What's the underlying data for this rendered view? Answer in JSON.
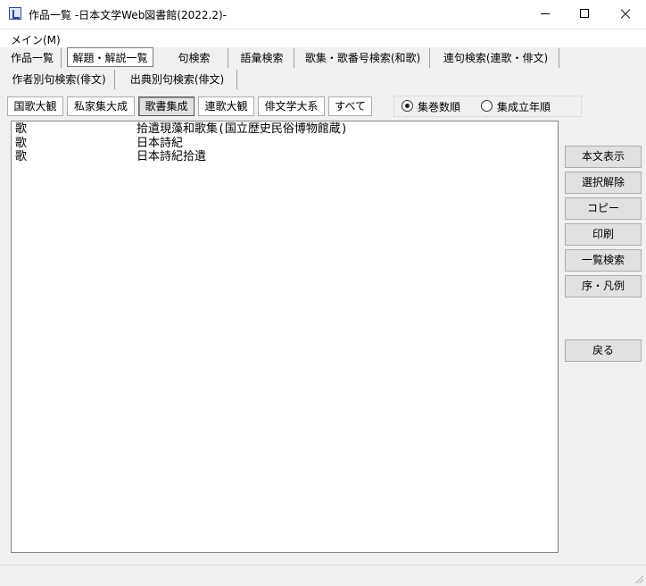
{
  "window": {
    "title": "作品一覧 -日本文学Web図書館(2022.2)-",
    "controls": {
      "minimize": "—",
      "maximize": "☐",
      "close": "✕"
    }
  },
  "menu": {
    "items": [
      "メイン(M)"
    ]
  },
  "tabs": {
    "row1": [
      "作品一覧",
      "解題・解説一覧",
      "句検索",
      "語彙検索",
      "歌集・歌番号検索(和歌)",
      "連句検索(連歌・俳文)"
    ],
    "row2": [
      "作者別句検索(俳文)",
      "出典別句検索(俳文)"
    ],
    "active": "解題・解説一覧"
  },
  "collections": {
    "buttons": [
      "国歌大観",
      "私家集大成",
      "歌書集成",
      "連歌大観",
      "俳文学大系",
      "すべて"
    ],
    "selected": "歌書集成"
  },
  "sort": {
    "options": [
      "集巻数順",
      "集成立年順"
    ],
    "selected": "集巻数順"
  },
  "list": {
    "rows": [
      {
        "type": "歌",
        "title": "拾遺現藻和歌集(国立歴史民俗博物館蔵)"
      },
      {
        "type": "歌",
        "title": "日本詩紀"
      },
      {
        "type": "歌",
        "title": "日本詩紀拾遺"
      }
    ]
  },
  "side_buttons": {
    "show_text": "本文表示",
    "deselect": "選択解除",
    "copy": "コピー",
    "print": "印刷",
    "list_search": "一覧検索",
    "preface": "序・凡例",
    "back": "戻る"
  }
}
